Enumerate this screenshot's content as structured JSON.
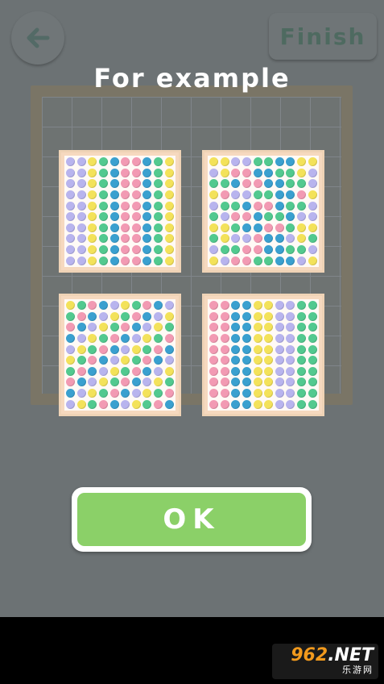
{
  "header": {
    "back_icon": "arrow-left-icon",
    "finish_label": "Finish"
  },
  "dialog": {
    "title": "For example",
    "ok_label": "OK"
  },
  "colors": {
    "overlay": "#6c7274",
    "ok_green": "#8bd068",
    "pink": "#f29ab3",
    "yellow": "#f3e25a",
    "lavender": "#b8b4ee",
    "green": "#52c98f",
    "blue": "#3aa0cf",
    "grid_frame": "#f6d9bf"
  },
  "examples": [
    {
      "name": "vertical-stripes-mixed",
      "rows": [
        "LLYGBPPBGY",
        "LLYGBPPBGY",
        "LLYGBPPBGY",
        "LLYGBPPBGY",
        "LLYGBPPBGY",
        "LLYGBPPBGY",
        "LLYGBPPBGY",
        "LLYGBPPBGY",
        "LLYGBPPBGY",
        "LLYGBPPBGY"
      ]
    },
    {
      "name": "symmetric-pattern",
      "rows": [
        "YYLLGGBBYY",
        "LYPPBBGGYL",
        "GGBPPBBGGL",
        "YPLLGGBBPY",
        "LGGBPPBGGL",
        "GLPPBGGBLL",
        "YYGBBPPGYY",
        "GYLLPBBLYG",
        "LGGPPBBGGL",
        "YLPPGGBBLY"
      ]
    },
    {
      "name": "diagonal-pattern",
      "rows": [
        "YGPBLYGPBL",
        "GPBLYGPBLY",
        "PBLYGPBLYG",
        "BLYGPBLYGP",
        "LYGPBLYGPB",
        "YGPBLYGPBL",
        "GPBLYGPBLY",
        "PBLYGPBLYG",
        "BLYGPBLYGP",
        "LYGPBLYGPB"
      ]
    },
    {
      "name": "column-blocks",
      "rows": [
        "PPBBYYLLGG",
        "PPBBYYLLGG",
        "PPBBYYLLGG",
        "PPBBYYLLGG",
        "PPBBYYLLGG",
        "PPBBYYLLGG",
        "PPBBYYLLGG",
        "PPBBYYLLGG",
        "PPBBYYLLGG",
        "PPBBYYLLGG"
      ]
    }
  ],
  "watermark": {
    "top_num": "962",
    "top_suffix": ".NET",
    "bottom": "乐游网"
  }
}
